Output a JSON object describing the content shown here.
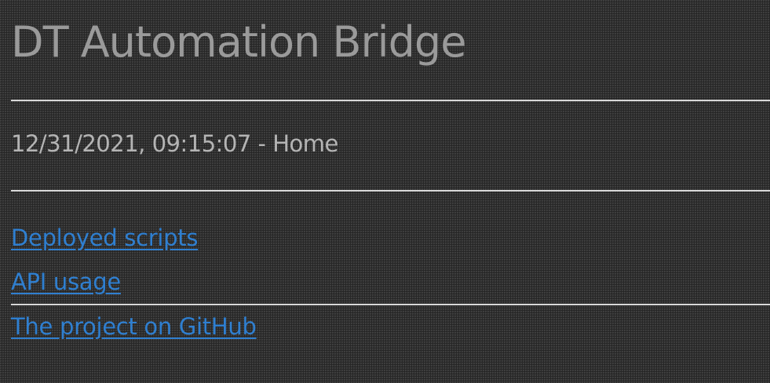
{
  "header": {
    "title": "DT Automation Bridge"
  },
  "status": {
    "text": "12/31/2021, 09:15:07 - Home"
  },
  "nav": {
    "links": [
      {
        "label": "Deployed scripts"
      },
      {
        "label": "API usage"
      },
      {
        "label": "The project on GitHub"
      }
    ]
  },
  "colors": {
    "background": "#2b2b2b",
    "title": "#9a9a9a",
    "text": "#b4b4b4",
    "link": "#2f7fd0",
    "rule": "#d8d8d8"
  }
}
